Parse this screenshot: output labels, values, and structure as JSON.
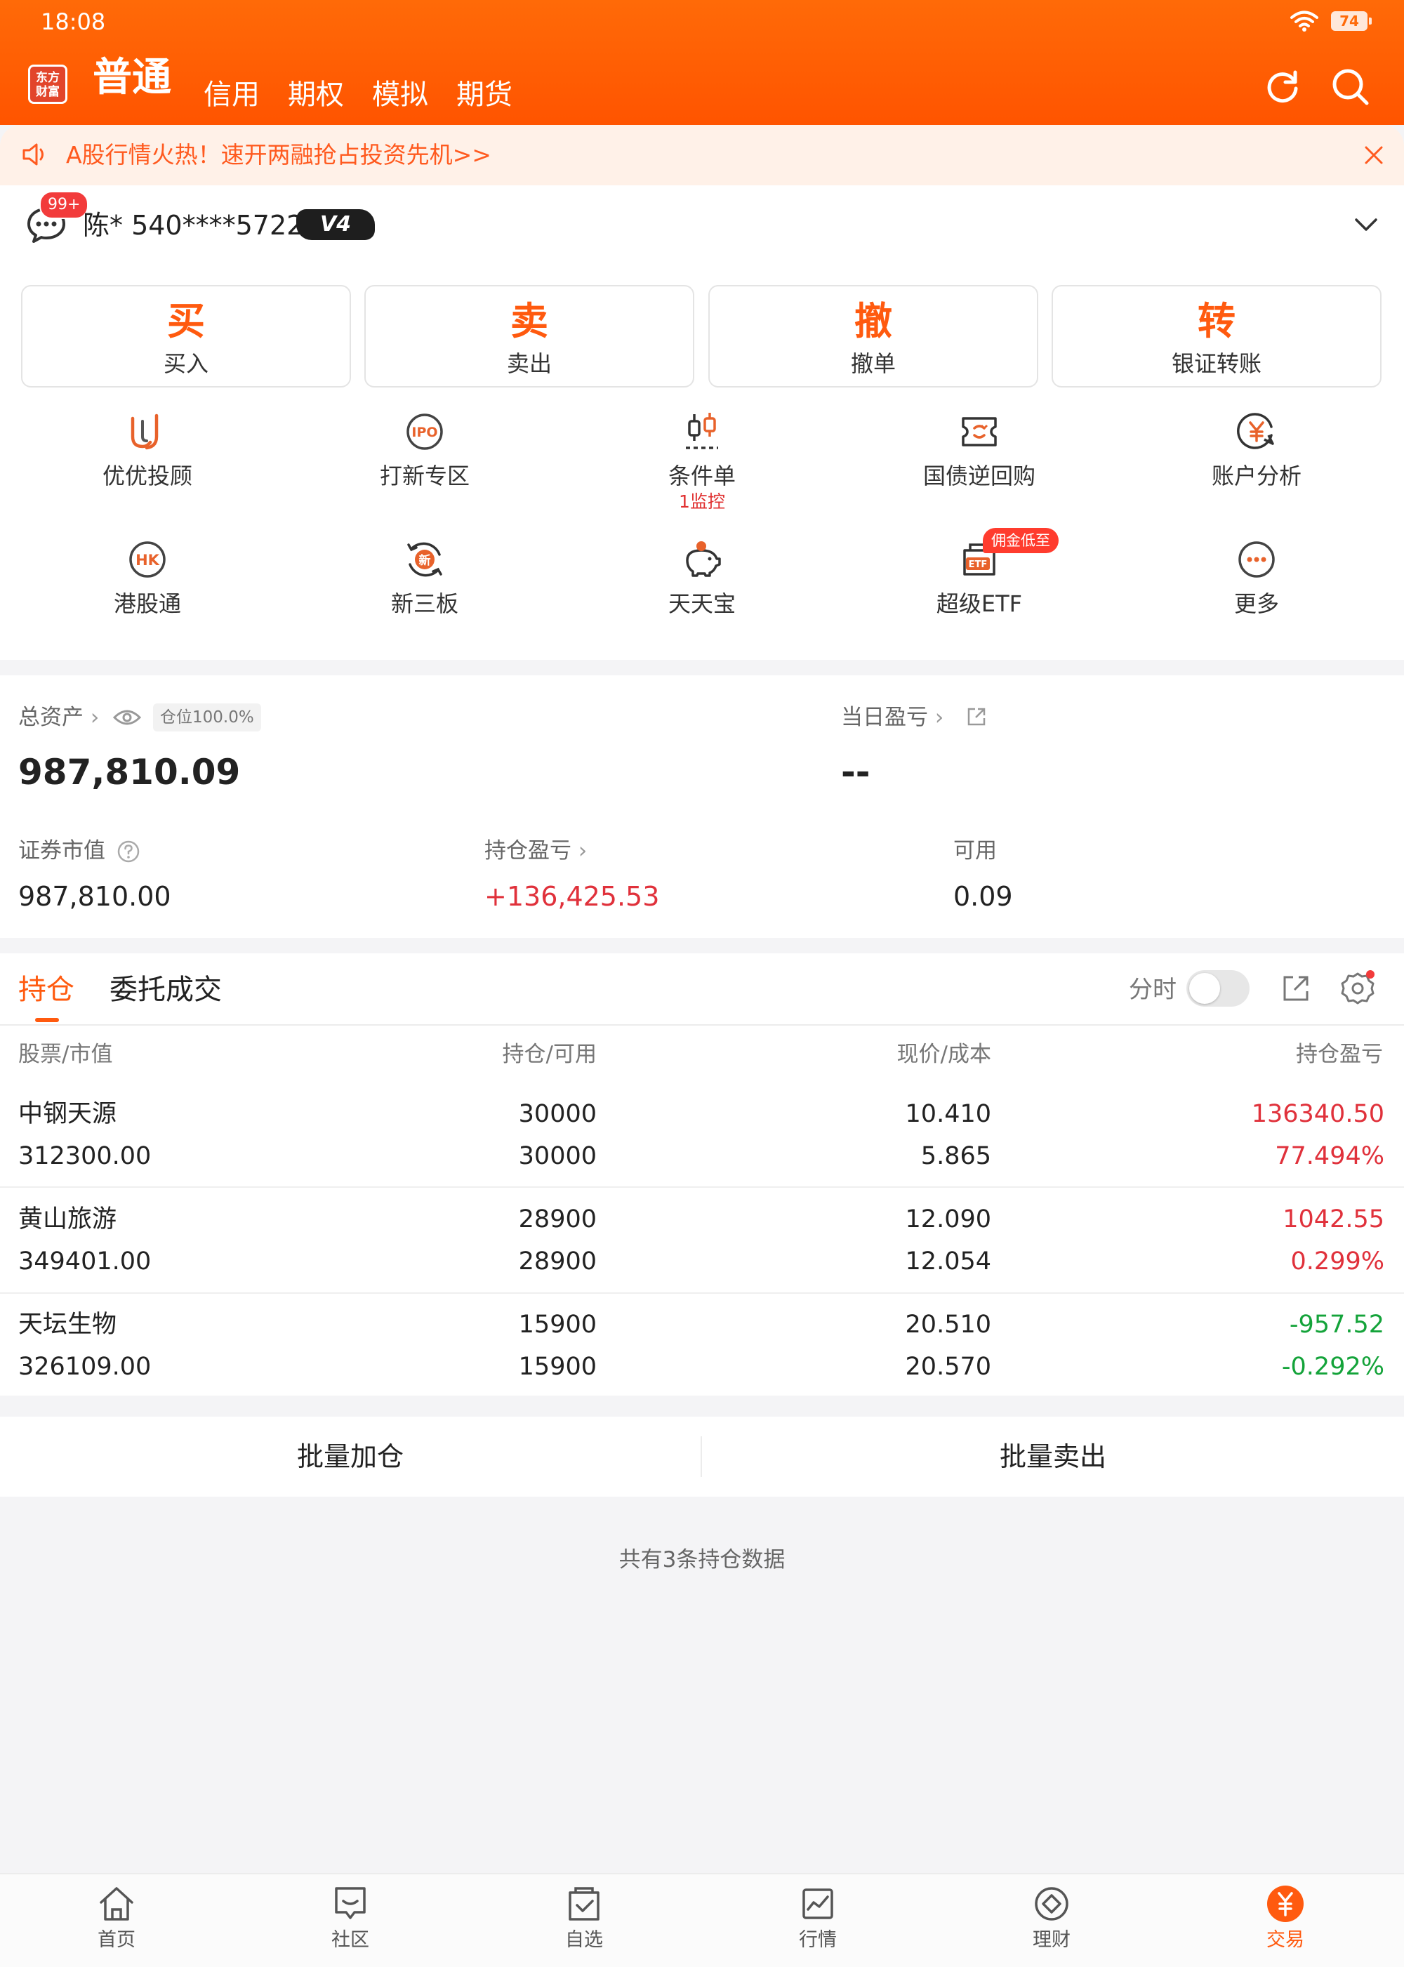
{
  "status_bar": {
    "time": "18:08",
    "battery": "74"
  },
  "header": {
    "logo_text": "东方\n财富",
    "tabs": [
      "普通",
      "信用",
      "期权",
      "模拟",
      "期货"
    ]
  },
  "banner": {
    "text": "A股行情火热！速开两融抢占投资先机>>"
  },
  "account": {
    "message_badge": "99+",
    "name": "陈* 540****5722",
    "vip_level": "V4"
  },
  "trade_buttons": [
    {
      "glyph": "买",
      "label": "买入"
    },
    {
      "glyph": "卖",
      "label": "卖出"
    },
    {
      "glyph": "撤",
      "label": "撤单"
    },
    {
      "glyph": "转",
      "label": "银证转账"
    }
  ],
  "features": [
    {
      "label": "优优投顾",
      "icon": "advisor-icon"
    },
    {
      "label": "打新专区",
      "icon": "ipo-icon"
    },
    {
      "label": "条件单",
      "sub": "1监控",
      "icon": "candlestick-icon"
    },
    {
      "label": "国债逆回购",
      "icon": "repo-icon"
    },
    {
      "label": "账户分析",
      "icon": "yen-analysis-icon"
    },
    {
      "label": "港股通",
      "icon": "hk-icon"
    },
    {
      "label": "新三板",
      "icon": "new-third-board-icon"
    },
    {
      "label": "天天宝",
      "icon": "piggy-bank-icon"
    },
    {
      "label": "超级ETF",
      "icon": "etf-icon",
      "badge": "佣金低至"
    },
    {
      "label": "更多",
      "icon": "more-icon"
    }
  ],
  "assets": {
    "total_label": "总资产",
    "position_tag": "仓位100.0%",
    "total_value": "987,810.09",
    "daily_pnl_label": "当日盈亏",
    "daily_pnl_value": "--",
    "market_value_label": "证券市值",
    "market_value": "987,810.00",
    "position_pnl_label": "持仓盈亏",
    "position_pnl": "+136,425.53",
    "available_label": "可用",
    "available": "0.09"
  },
  "holdings": {
    "tabs": [
      "持仓",
      "委托成交"
    ],
    "fenshi_label": "分时",
    "fenshi_on": false,
    "columns": [
      "股票/市值",
      "持仓/可用",
      "现价/成本",
      "持仓盈亏"
    ],
    "rows": [
      {
        "name": "中钢天源",
        "market_value": "312300.00",
        "position": "30000",
        "available": "30000",
        "price": "10.410",
        "cost": "5.865",
        "pnl": "136340.50",
        "pnl_pct": "77.494%",
        "direction": "up"
      },
      {
        "name": "黄山旅游",
        "market_value": "349401.00",
        "position": "28900",
        "available": "28900",
        "price": "12.090",
        "cost": "12.054",
        "pnl": "1042.55",
        "pnl_pct": "0.299%",
        "direction": "up"
      },
      {
        "name": "天坛生物",
        "market_value": "326109.00",
        "position": "15900",
        "available": "15900",
        "price": "20.510",
        "cost": "20.570",
        "pnl": "-957.52",
        "pnl_pct": "-0.292%",
        "direction": "down"
      }
    ],
    "batch_add": "批量加仓",
    "batch_sell": "批量卖出",
    "total_count": "共有3条持仓数据"
  },
  "bottom_nav": [
    {
      "label": "首页",
      "icon": "home-icon"
    },
    {
      "label": "社区",
      "icon": "community-icon"
    },
    {
      "label": "自选",
      "icon": "watchlist-icon"
    },
    {
      "label": "行情",
      "icon": "market-icon"
    },
    {
      "label": "理财",
      "icon": "wealth-icon"
    },
    {
      "label": "交易",
      "icon": "trade-icon",
      "active": true
    }
  ],
  "colors": {
    "brand": "#ff5a0f",
    "up": "#e0313b",
    "down": "#14a33a"
  }
}
